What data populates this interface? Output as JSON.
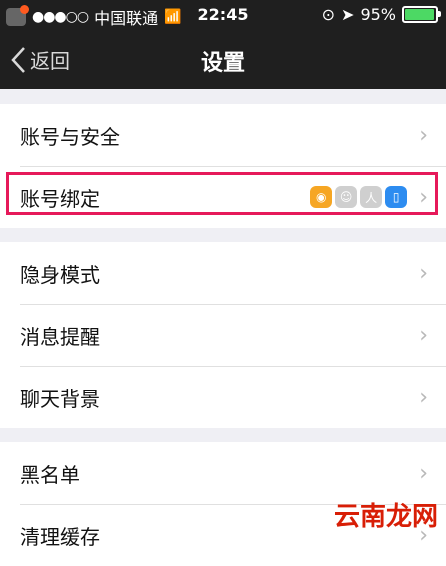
{
  "statusbar": {
    "carrier": "中国联通",
    "time": "22:45",
    "battery": "95%"
  },
  "navbar": {
    "back_label": "返回",
    "title": "设置"
  },
  "groups": [
    {
      "items": [
        {
          "label": "账号与安全"
        },
        {
          "label": "账号绑定",
          "bindings": [
            "weibo-icon",
            "contacts-icon",
            "renren-icon",
            "phone-icon"
          ]
        }
      ]
    },
    {
      "items": [
        {
          "label": "隐身模式"
        },
        {
          "label": "消息提醒"
        },
        {
          "label": "聊天背景"
        }
      ]
    },
    {
      "items": [
        {
          "label": "黑名单"
        },
        {
          "label": "清理缓存"
        }
      ]
    }
  ],
  "watermark": "云南龙网",
  "colors": {
    "header_bg": "#1f1f1f",
    "highlight": "#e6195a",
    "battery_green": "#4cd964"
  }
}
